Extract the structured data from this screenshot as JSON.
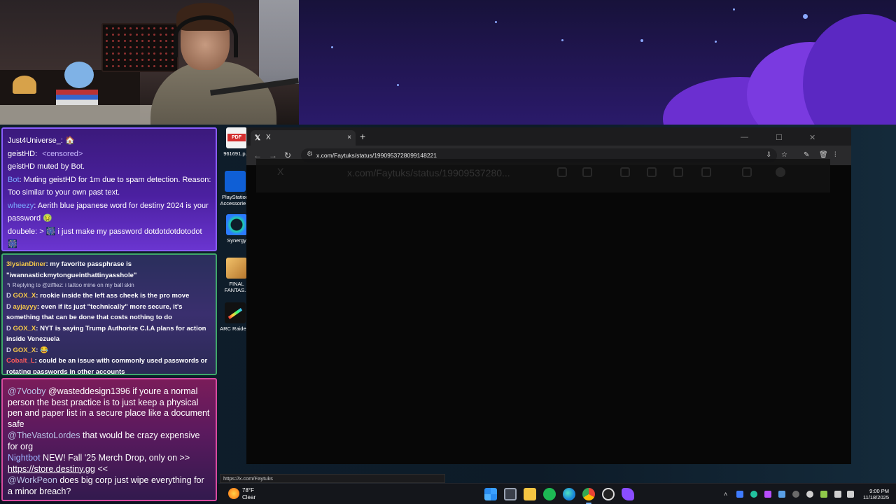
{
  "chat_panel_1": {
    "messages": [
      {
        "user": "Just4Universe_",
        "text": ": 🏠"
      },
      {
        "user": "geistHD",
        "text": ": ",
        "extra": "<censored>"
      },
      {
        "user": "",
        "text": "geistHD muted by Bot."
      },
      {
        "user": "Bot",
        "text": ": Muting geistHD for 1m due to spam detection. Reason: Too similar to your own past text."
      },
      {
        "user": "wheezy",
        "text": ": Aerith blue japanese word for destiny 2024 is your password 🤢"
      },
      {
        "user": "doubele",
        "text": ": > 🎆 i just make my password dotdotdotdotodot 🎆"
      }
    ]
  },
  "chat_panel_2": {
    "messages": [
      {
        "prefix": "",
        "user": "3lysianDiner",
        "text": ": my favorite passphrase is \"iwannastickmytongueinthattinyasshole\""
      },
      {
        "reply": "↰ Replying to @ziffiez: i tattoo mine on my ball skin"
      },
      {
        "prefix": "D",
        "user": "GOX_X",
        "text": ": rookie inside the left ass cheek is the pro move"
      },
      {
        "prefix": "D",
        "user": "ayjayyy",
        "text": ": even if its just \"technically\" more secure, it's something that can be done that costs nothing to do"
      },
      {
        "prefix": "D",
        "user": "GOX_X",
        "text": ": NYT is saying Trump Authorize C.I.A plans for action inside Venezuela"
      },
      {
        "prefix": "D",
        "user": "GOX_X",
        "text": ": 😂"
      },
      {
        "prefix": "",
        "user": "Cobalt_L",
        "text": ": could be an issue with commonly used passwords or rotating passwords in other accounts"
      }
    ]
  },
  "chat_panel_3": {
    "messages": [
      {
        "user": "@7Vooby",
        "text": "@wasteddesign1396 if youre a normal person the best practice is to just keep a physical pen and paper list in a secure place like a document safe"
      },
      {
        "user": "@TheVastoLordes",
        "text": "that would be crazy expensive for org"
      },
      {
        "user": "Nightbot",
        "text": "NEW! Fall '25 Merch Drop, only on >> ",
        "link": "https://store.destiny.gg",
        "after": " <<"
      },
      {
        "user": "@WorkPeon",
        "text": "does big corp just wipe everything for a minor breach?"
      }
    ]
  },
  "desktop_icons": [
    {
      "label": "961691.p...",
      "icon": "pdf-icon"
    },
    {
      "label": "PlayStation Accessorie...",
      "icon": "playstation-accessories-icon"
    },
    {
      "label": "Synergy",
      "icon": "synergy-icon"
    },
    {
      "label": "FINAL FANTAS...",
      "icon": "final-fantasy-icon"
    },
    {
      "label": "ARC Raiders",
      "icon": "arc-raiders-icon"
    }
  ],
  "browser": {
    "tab_title": "X",
    "tab_close": "×",
    "new_tab": "+",
    "url": "x.com/Faytuks/status/1990953728099148221",
    "ghost_url": "x.com/Faytuks/status/19909537280...",
    "ghost_tab": "X",
    "status_url": "https://x.com/Faytuks"
  },
  "taskbar": {
    "weather_temp": "78°F",
    "weather_desc": "Clear",
    "time": "9:00 PM",
    "date": "11/18/2025"
  },
  "colors": {
    "chat1_border": "#8a5cff",
    "chat2_border": "#3fa86a",
    "chat3_border": "#d94aa0",
    "nightbot": "#7aa9ff"
  }
}
